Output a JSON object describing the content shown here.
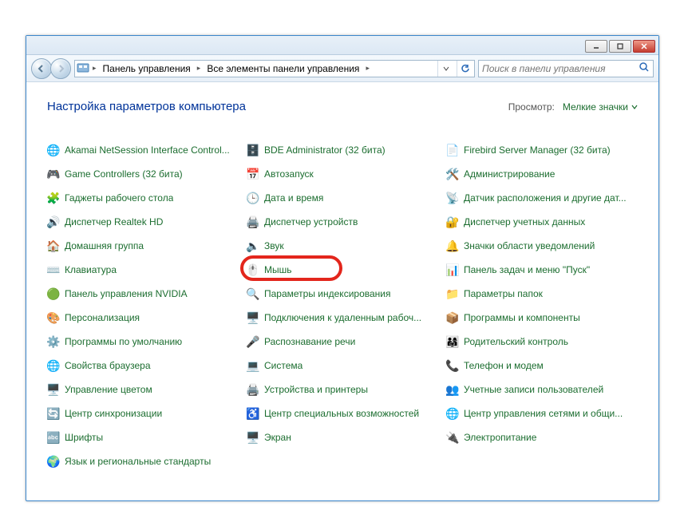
{
  "breadcrumb": {
    "part1": "Панель управления",
    "part2": "Все элементы панели управления"
  },
  "search": {
    "placeholder": "Поиск в панели управления"
  },
  "page_title": "Настройка параметров компьютера",
  "view": {
    "label": "Просмотр:",
    "value": "Мелкие значки"
  },
  "columns": [
    [
      {
        "icon": "🌐",
        "label": "Akamai NetSession Interface Control..."
      },
      {
        "icon": "🎮",
        "label": "Game Controllers (32 бита)"
      },
      {
        "icon": "🧩",
        "label": "Гаджеты рабочего стола"
      },
      {
        "icon": "🔊",
        "label": "Диспетчер Realtek HD"
      },
      {
        "icon": "🏠",
        "label": "Домашняя группа"
      },
      {
        "icon": "⌨️",
        "label": "Клавиатура"
      },
      {
        "icon": "🟢",
        "label": "Панель управления NVIDIA"
      },
      {
        "icon": "🎨",
        "label": "Персонализация"
      },
      {
        "icon": "⚙️",
        "label": "Программы по умолчанию"
      },
      {
        "icon": "🌐",
        "label": "Свойства браузера"
      },
      {
        "icon": "🖥️",
        "label": "Управление цветом"
      },
      {
        "icon": "🔄",
        "label": "Центр синхронизации"
      },
      {
        "icon": "🔤",
        "label": "Шрифты"
      },
      {
        "icon": "🌍",
        "label": "Язык и региональные стандарты"
      }
    ],
    [
      {
        "icon": "🗄️",
        "label": "BDE Administrator (32 бита)"
      },
      {
        "icon": "📅",
        "label": "Автозапуск"
      },
      {
        "icon": "🕒",
        "label": "Дата и время"
      },
      {
        "icon": "🖨️",
        "label": "Диспетчер устройств"
      },
      {
        "icon": "🔈",
        "label": "Звук"
      },
      {
        "icon": "🖱️",
        "label": "Мышь",
        "highlighted": true
      },
      {
        "icon": "🔍",
        "label": "Параметры индексирования"
      },
      {
        "icon": "🖥️",
        "label": "Подключения к удаленным рабоч..."
      },
      {
        "icon": "🎤",
        "label": "Распознавание речи"
      },
      {
        "icon": "💻",
        "label": "Система"
      },
      {
        "icon": "🖨️",
        "label": "Устройства и принтеры"
      },
      {
        "icon": "♿",
        "label": "Центр специальных возможностей"
      },
      {
        "icon": "🖥️",
        "label": "Экран"
      }
    ],
    [
      {
        "icon": "📄",
        "label": "Firebird Server Manager (32 бита)"
      },
      {
        "icon": "🛠️",
        "label": "Администрирование"
      },
      {
        "icon": "📡",
        "label": "Датчик расположения и другие дат..."
      },
      {
        "icon": "🔐",
        "label": "Диспетчер учетных данных"
      },
      {
        "icon": "🔔",
        "label": "Значки области уведомлений"
      },
      {
        "icon": "📊",
        "label": "Панель задач и меню \"Пуск\""
      },
      {
        "icon": "📁",
        "label": "Параметры папок"
      },
      {
        "icon": "📦",
        "label": "Программы и компоненты"
      },
      {
        "icon": "👨‍👩‍👧",
        "label": "Родительский контроль"
      },
      {
        "icon": "📞",
        "label": "Телефон и модем"
      },
      {
        "icon": "👥",
        "label": "Учетные записи пользователей"
      },
      {
        "icon": "🌐",
        "label": "Центр управления сетями и общи..."
      },
      {
        "icon": "🔌",
        "label": "Электропитание"
      }
    ]
  ]
}
